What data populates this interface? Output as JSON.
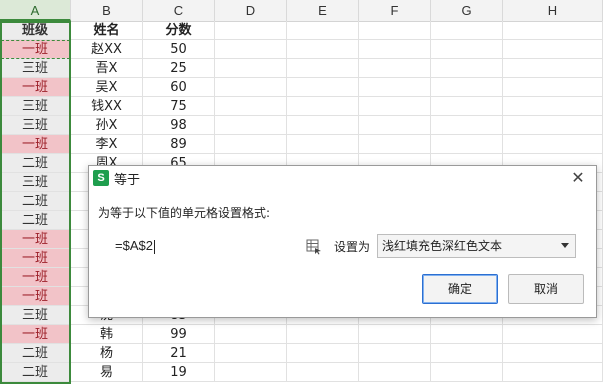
{
  "columns": [
    "A",
    "B",
    "C",
    "D",
    "E",
    "F",
    "G",
    "H"
  ],
  "table": {
    "headers": [
      "班级",
      "姓名",
      "分数"
    ],
    "rows": [
      {
        "class": "一班",
        "name": "赵XX",
        "score": "50",
        "hl": true
      },
      {
        "class": "三班",
        "name": "吾X",
        "score": "25",
        "hl": false
      },
      {
        "class": "一班",
        "name": "吴X",
        "score": "60",
        "hl": true
      },
      {
        "class": "三班",
        "name": "钱XX",
        "score": "75",
        "hl": false
      },
      {
        "class": "三班",
        "name": "孙X",
        "score": "98",
        "hl": false
      },
      {
        "class": "一班",
        "name": "李X",
        "score": "89",
        "hl": true
      },
      {
        "class": "二班",
        "name": "周X",
        "score": "65",
        "hl": false
      },
      {
        "class": "三班",
        "name": "",
        "score": "",
        "hl": false
      },
      {
        "class": "二班",
        "name": "",
        "score": "",
        "hl": false
      },
      {
        "class": "二班",
        "name": "",
        "score": "",
        "hl": false
      },
      {
        "class": "一班",
        "name": "",
        "score": "",
        "hl": true
      },
      {
        "class": "一班",
        "name": "",
        "score": "",
        "hl": true
      },
      {
        "class": "一班",
        "name": "",
        "score": "",
        "hl": true
      },
      {
        "class": "一班",
        "name": "",
        "score": "",
        "hl": true
      },
      {
        "class": "三班",
        "name": "沈",
        "score": "83",
        "hl": false
      },
      {
        "class": "一班",
        "name": "韩",
        "score": "99",
        "hl": true
      },
      {
        "class": "二班",
        "name": "杨",
        "score": "21",
        "hl": false
      },
      {
        "class": "二班",
        "name": "易",
        "score": "19",
        "hl": false
      }
    ]
  },
  "dialog": {
    "app_icon": "S",
    "title": "等于",
    "close": "✕",
    "prompt": "为等于以下值的单元格设置格式:",
    "value": "=$A$2",
    "set_label": "设置为",
    "format_selected": "浅红填充色深红色文本",
    "ok": "确定",
    "cancel": "取消"
  },
  "colors": {
    "highlight_fill": "#f2c3c8",
    "highlight_text": "#9c1f28",
    "selection": "#3c8a3c",
    "app_icon": "#1e9e4e"
  }
}
